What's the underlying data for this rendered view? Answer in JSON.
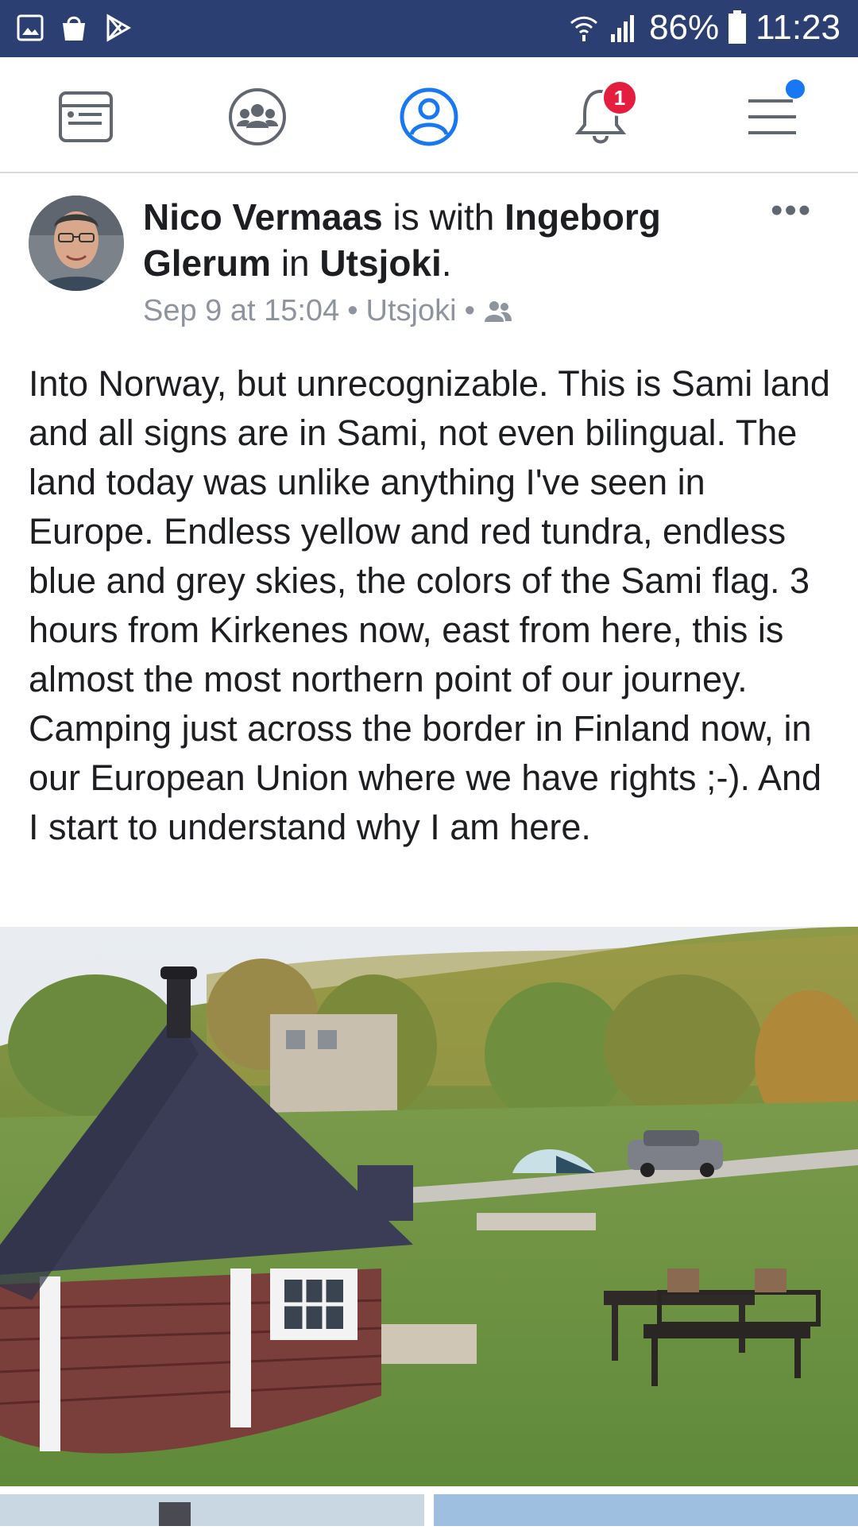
{
  "status_bar": {
    "left_icons": [
      "gallery-icon",
      "shopping-bag-icon",
      "play-store-icon"
    ],
    "battery": "86%",
    "time": "11:23"
  },
  "nav": {
    "items": [
      {
        "name": "news-feed-icon"
      },
      {
        "name": "groups-icon"
      },
      {
        "name": "profile-icon",
        "active": true
      },
      {
        "name": "notifications-icon",
        "badge": "1"
      },
      {
        "name": "menu-icon",
        "dot": true
      }
    ],
    "accent": "#1877f2"
  },
  "post": {
    "author": "Nico Vermaas",
    "connector1": "is with",
    "tagged": "Ingeborg Glerum",
    "connector2": "in",
    "place": "Utsjoki",
    "period": ".",
    "timestamp": "Sep 9 at 15:04",
    "location": "Utsjoki",
    "separator": "•",
    "privacy_icon": "friends-icon",
    "text": "Into Norway, but unrecognizable. This is Sami land and all signs are in Sami, not even bilingual. The land today was unlike anything I've seen in Europe. Endless yellow and red tundra, endless blue and grey skies, the colors of the Sami flag. 3 hours from Kirkenes now, east from here, this is almost the most northern point of our journey. Camping just across the border in Finland now, in our European Union where we have rights ;-). And I start to understand why I am here.",
    "more_label": "•••"
  }
}
